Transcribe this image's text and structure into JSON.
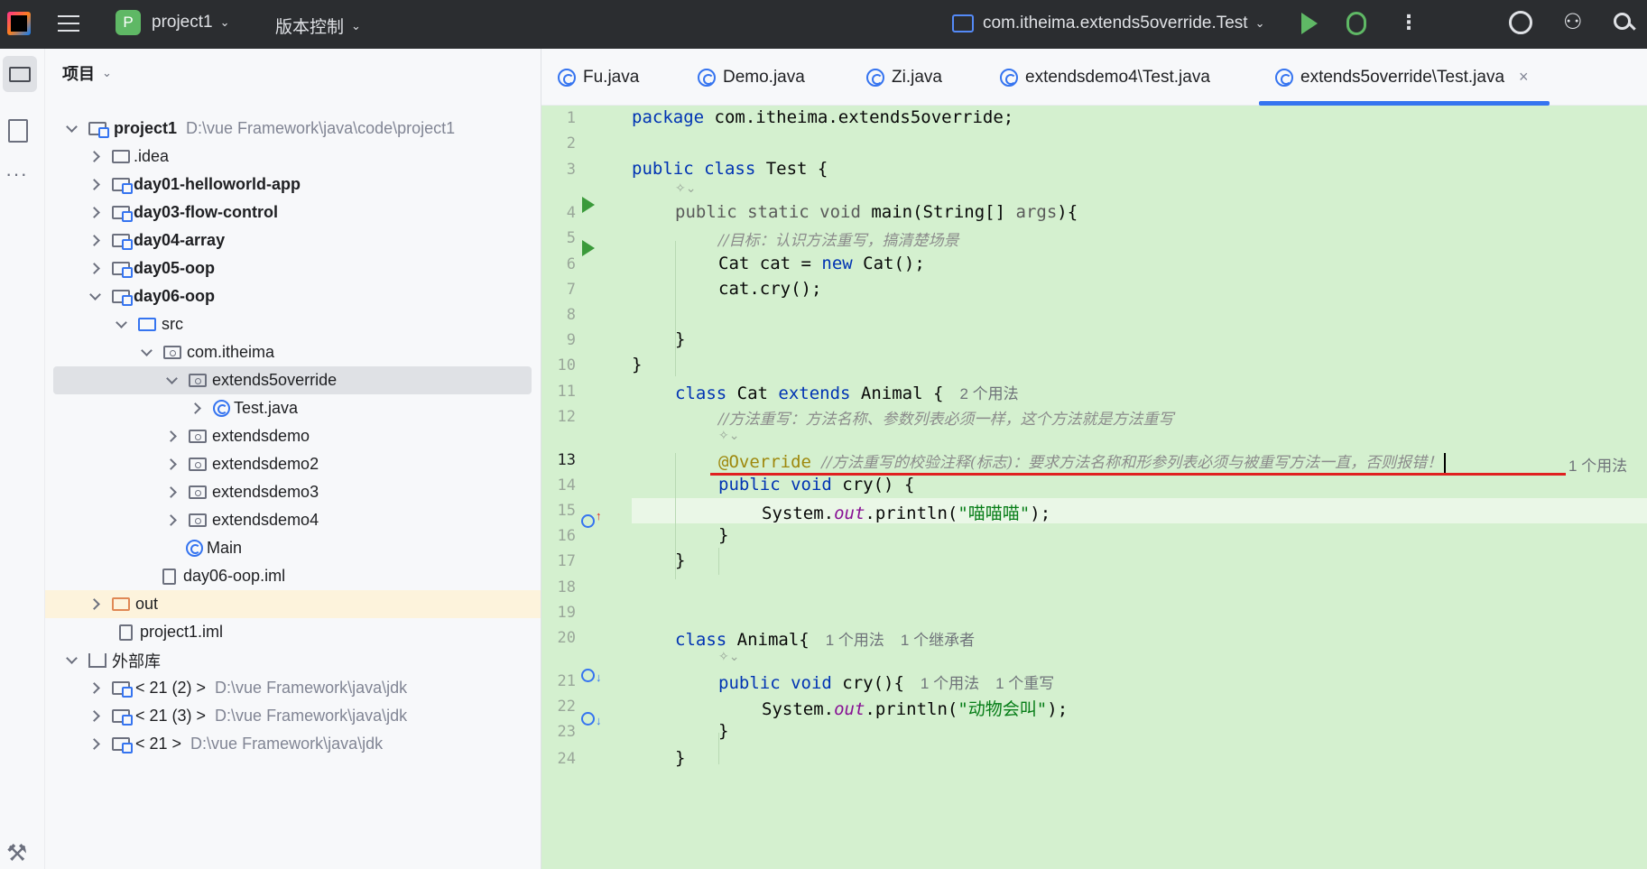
{
  "titlebar": {
    "project_badge": "P",
    "project_name": "project1",
    "vcs_label": "版本控制",
    "run_config": "com.itheima.extends5override.Test"
  },
  "panel": {
    "title": "项目"
  },
  "tree": [
    {
      "label": "project1",
      "path": "D:\\vue  Framework\\java\\code\\project1",
      "bold": true
    },
    {
      "label": ".idea"
    },
    {
      "label": "day01-helloworld-app",
      "bold": true
    },
    {
      "label": "day03-flow-control",
      "bold": true
    },
    {
      "label": "day04-array",
      "bold": true
    },
    {
      "label": "day05-oop",
      "bold": true
    },
    {
      "label": "day06-oop",
      "bold": true
    },
    {
      "label": "src"
    },
    {
      "label": "com.itheima"
    },
    {
      "label": "extends5override"
    },
    {
      "label": "Test.java"
    },
    {
      "label": "extendsdemo"
    },
    {
      "label": "extendsdemo2"
    },
    {
      "label": "extendsdemo3"
    },
    {
      "label": "extendsdemo4"
    },
    {
      "label": "Main"
    },
    {
      "label": "day06-oop.iml"
    },
    {
      "label": "out"
    },
    {
      "label": "project1.iml"
    },
    {
      "label": "外部库"
    },
    {
      "label": "< 21 (2) >",
      "path": "D:\\vue  Framework\\java\\jdk"
    },
    {
      "label": "< 21 (3) >",
      "path": "D:\\vue  Framework\\java\\jdk"
    },
    {
      "label": "< 21 >",
      "path": "D:\\vue  Framework\\java\\jdk"
    }
  ],
  "tabs": [
    "Fu.java",
    "Demo.java",
    "Zi.java",
    "extendsdemo4\\Test.java",
    "extends5override\\Test.java"
  ],
  "code": {
    "l1_kw": "package",
    "l1_rest": " com.itheima.extends5override;",
    "l3_kw": "public class",
    "l3_rest": " Test {",
    "l4_kw": "public static void",
    "l4_rest": " main(String[] ",
    "l4_param": "args",
    "l4_end": "){",
    "l5_comment": "//目标：认识方法重写，搞清楚场景",
    "l6_a": "Cat cat = ",
    "l6_kw": "new",
    "l6_b": " Cat();",
    "l7": "cat.cry();",
    "l9": "}",
    "l10": "}",
    "l11_kw": "class",
    "l11_a": " Cat ",
    "l11_kw2": "extends",
    "l11_b": " Animal {",
    "l11_hint": "2 个用法",
    "l12_comment": "//方法重写：方法名称、参数列表必须一样，这个方法就是方法重写",
    "l13_annot": "@Override",
    "l13_comment": "//方法重写的校验注释(标志)：要求方法名称和形参列表必须与被重写方法一直，否则报错！",
    "l13_hint": "1 个用法",
    "l14_kw": "public void",
    "l14_rest": " cry() {",
    "l15_a": "System.",
    "l15_field": "out",
    "l15_b": ".println(",
    "l15_str": "\"喵喵喵\"",
    "l15_c": ");",
    "l16": "}",
    "l17": "}",
    "l20_kw": "class",
    "l20_rest": " Animal{",
    "l20_hint1": "1 个用法",
    "l20_hint2": "1 个继承者",
    "l21_kw": "public void",
    "l21_rest": " cry(){",
    "l21_hint1": "1 个用法",
    "l21_hint2": "1 个重写",
    "l22_a": "System.",
    "l22_field": "out",
    "l22_b": ".println(",
    "l22_str": "\"动物会叫\"",
    "l22_c": ");",
    "l23": "}",
    "l24": "}"
  },
  "line_numbers": [
    "1",
    "2",
    "3",
    "4",
    "5",
    "6",
    "7",
    "8",
    "9",
    "10",
    "11",
    "12",
    "13",
    "14",
    "15",
    "16",
    "17",
    "18",
    "19",
    "20",
    "21",
    "22",
    "23",
    "24"
  ],
  "colors": {
    "accent": "#3574f0",
    "editor_bg": "#d4f0cf",
    "error_underline": "#e02020"
  }
}
